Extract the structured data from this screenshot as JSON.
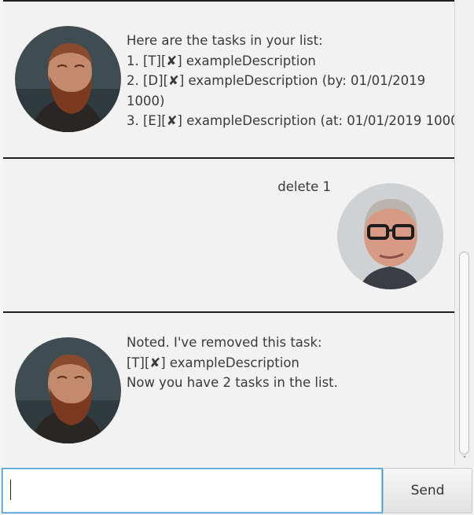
{
  "messages": [
    {
      "sender": "duke",
      "lines": [
        "Here are the tasks in your list:",
        "1. [T][✘] exampleDescription",
        "2. [D][✘] exampleDescription (by: 01/01/2019",
        "1000)",
        "3. [E][✘] exampleDescription (at: 01/01/2019 1000..."
      ]
    },
    {
      "sender": "user",
      "lines": [
        "delete 1"
      ]
    },
    {
      "sender": "duke",
      "lines": [
        "Noted. I've removed this task:",
        "[T][✘] exampleDescription",
        "Now you have 2 tasks in the list."
      ]
    }
  ],
  "input": {
    "value": "",
    "placeholder": ""
  },
  "send_button": {
    "label": "Send"
  },
  "scrollbar": {
    "down_arrow": "˅"
  }
}
